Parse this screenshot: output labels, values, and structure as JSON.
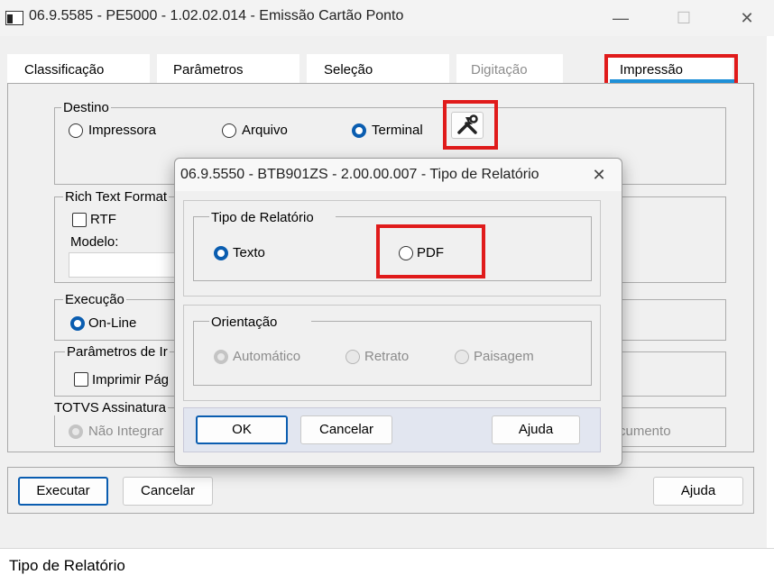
{
  "window": {
    "title": "06.9.5585 - PE5000 - 1.02.02.014 - Emissão Cartão Ponto",
    "minimize": "—",
    "maximize": "☐",
    "close": "✕"
  },
  "tabs": [
    {
      "label": "Classificação",
      "state": "normal"
    },
    {
      "label": "Parâmetros",
      "state": "normal"
    },
    {
      "label": "Seleção",
      "state": "normal"
    },
    {
      "label": "Digitação",
      "state": "disabled"
    },
    {
      "label": "Impressão",
      "state": "active"
    }
  ],
  "destino": {
    "label": "Destino",
    "options": [
      "Impressora",
      "Arquivo",
      "Terminal"
    ],
    "selected": "Terminal",
    "config_icon": "tools-icon"
  },
  "rtf": {
    "label": "Rich Text Format",
    "checkbox_label": "RTF",
    "model_label": "Modelo:"
  },
  "execucao": {
    "label": "Execução",
    "option": "On-Line"
  },
  "parametros_impressao": {
    "label": "Parâmetros de Ir",
    "checkbox_label": "Imprimir Pág"
  },
  "totvs": {
    "label": "TOTVS Assinatura",
    "option": "Não Integrar",
    "tail_text": "cumento"
  },
  "main_buttons": {
    "executar": "Executar",
    "cancelar": "Cancelar",
    "ajuda": "Ajuda"
  },
  "status_bar": {
    "text": "Tipo de Relatório"
  },
  "dialog": {
    "title": "06.9.5550 - BTB901ZS - 2.00.00.007 - Tipo de Relatório",
    "close": "✕",
    "tipo": {
      "label": "Tipo de Relatório",
      "options": [
        "Texto",
        "PDF"
      ],
      "selected": "Texto"
    },
    "orientacao": {
      "label": "Orientação",
      "options": [
        "Automático",
        "Retrato",
        "Paisagem"
      ],
      "selected": "Automático"
    },
    "buttons": {
      "ok": "OK",
      "cancelar": "Cancelar",
      "ajuda": "Ajuda"
    }
  },
  "colors": {
    "accent": "#0a5db0",
    "highlight": "#e01b1b",
    "tab_underline": "#1e90d8"
  }
}
